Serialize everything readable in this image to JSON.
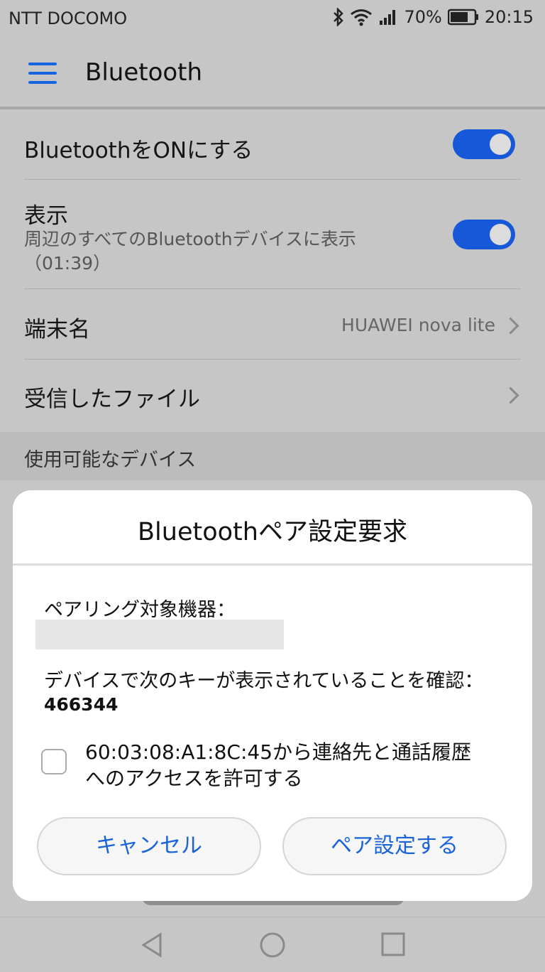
{
  "status_bar": {
    "carrier": "NTT DOCOMO",
    "battery_percent": "70%",
    "time": "20:15",
    "icons": [
      "bluetooth-icon",
      "wifi-icon",
      "signal-icon",
      "battery-icon"
    ]
  },
  "appbar": {
    "title": "Bluetooth",
    "menu_icon": "menu-icon"
  },
  "settings": {
    "bluetooth_on": {
      "label": "BluetoothをONにする",
      "enabled": true
    },
    "visibility": {
      "label": "表示",
      "sub_line1": "周辺のすべてのBluetoothデバイスに表示",
      "sub_line2": "（01:39）",
      "enabled": true
    },
    "device_name": {
      "label": "端末名",
      "value": "HUAWEI nova lite"
    },
    "received_files": {
      "label": "受信したファイル"
    }
  },
  "section": {
    "available_devices": "使用可能なデバイス"
  },
  "dialog": {
    "title": "Bluetoothペア設定要求",
    "pair_label": "ペアリング対象機器：",
    "confirm_text": "デバイスで次のキーが表示されていることを確認：",
    "key": "466344",
    "consent_line1": "60:03:08:A1:8C:45から連絡先と通話履歴",
    "consent_line2": "へのアクセスを許可する",
    "consent_checked": false,
    "cancel_label": "キャンセル",
    "pair_label_button": "ペア設定する"
  },
  "colors": {
    "accent": "#1758d8",
    "button_text": "#1a63d6",
    "background": "#c6c6c6",
    "dialog": "#ffffff"
  }
}
